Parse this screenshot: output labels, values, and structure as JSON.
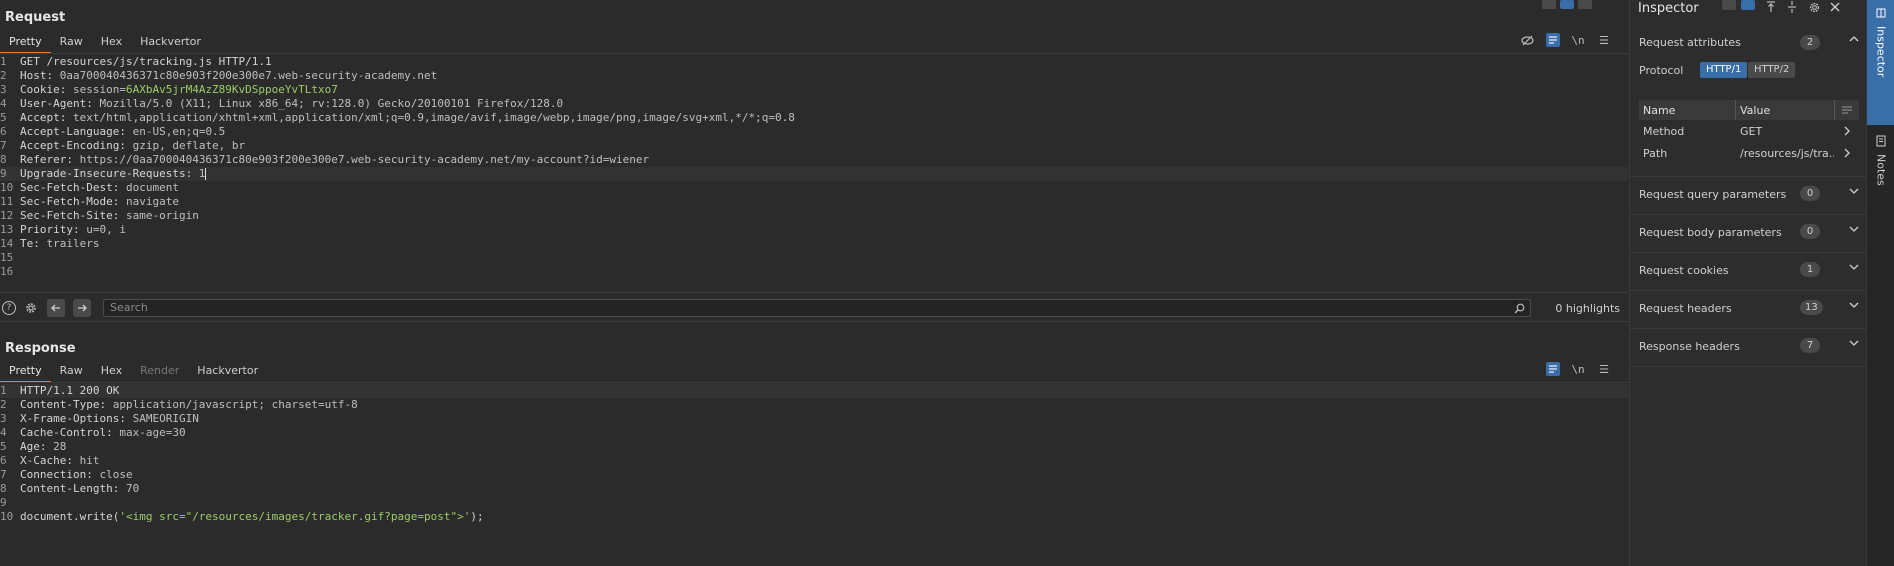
{
  "request": {
    "title": "Request",
    "tabs": [
      "Pretty",
      "Raw",
      "Hex",
      "Hackvertor"
    ],
    "active_tab": "Pretty",
    "lines": [
      {
        "n": "1",
        "name": "GET /resources/js/tracking.js HTTP/1.1",
        "value": ""
      },
      {
        "n": "2",
        "name": "Host:",
        "value": " 0aa700040436371c80e903f200e300e7.web-security-academy.net"
      },
      {
        "n": "3",
        "name": "Cookie:",
        "value": " session=",
        "extra": "6AXbAv5jrM4AzZ89KvDSppoeYvTLtxo7"
      },
      {
        "n": "4",
        "name": "User-Agent:",
        "value": " Mozilla/5.0 (X11; Linux x86_64; rv:128.0) Gecko/20100101 Firefox/128.0"
      },
      {
        "n": "5",
        "name": "Accept:",
        "value": " text/html,application/xhtml+xml,application/xml;q=0.9,image/avif,image/webp,image/png,image/svg+xml,*/*;q=0.8"
      },
      {
        "n": "6",
        "name": "Accept-Language:",
        "value": " en-US,en;q=0.5"
      },
      {
        "n": "7",
        "name": "Accept-Encoding:",
        "value": " gzip, deflate, br"
      },
      {
        "n": "8",
        "name": "Referer:",
        "value": " https://0aa700040436371c80e903f200e300e7.web-security-academy.net/my-account?id=wiener"
      },
      {
        "n": "9",
        "name": "Upgrade-Insecure-Requests:",
        "value": " 1",
        "cursor": true
      },
      {
        "n": "10",
        "name": "Sec-Fetch-Dest:",
        "value": " document"
      },
      {
        "n": "11",
        "name": "Sec-Fetch-Mode:",
        "value": " navigate"
      },
      {
        "n": "12",
        "name": "Sec-Fetch-Site:",
        "value": " same-origin"
      },
      {
        "n": "13",
        "name": "Priority:",
        "value": " u=0, i"
      },
      {
        "n": "14",
        "name": "Te:",
        "value": " trailers"
      },
      {
        "n": "15",
        "name": "",
        "value": ""
      },
      {
        "n": "16",
        "name": "",
        "value": ""
      }
    ]
  },
  "search": {
    "placeholder": "Search",
    "highlights": "0 highlights"
  },
  "response": {
    "title": "Response",
    "tabs": [
      "Pretty",
      "Raw",
      "Hex",
      "Render",
      "Hackvertor"
    ],
    "active_tab": "Pretty",
    "disabled_tab": "Render",
    "lines": [
      {
        "n": "1",
        "name": "HTTP/1.1 200 OK",
        "value": ""
      },
      {
        "n": "2",
        "name": "Content-Type:",
        "value": " application/javascript; charset=utf-8"
      },
      {
        "n": "3",
        "name": "X-Frame-Options:",
        "value": " SAMEORIGIN"
      },
      {
        "n": "4",
        "name": "Cache-Control:",
        "value": " max-age=30"
      },
      {
        "n": "5",
        "name": "Age:",
        "value": " 28"
      },
      {
        "n": "6",
        "name": "X-Cache:",
        "value": " hit"
      },
      {
        "n": "7",
        "name": "Connection:",
        "value": " close"
      },
      {
        "n": "8",
        "name": "Content-Length:",
        "value": " 70"
      },
      {
        "n": "9",
        "name": "",
        "value": ""
      },
      {
        "n": "10",
        "name": "document.write(",
        "value": "",
        "extra": "'<img src=\"/resources/images/tracker.gif?page=post\">'",
        "tail": ");"
      }
    ]
  },
  "inspector": {
    "title": "Inspector",
    "attributes": {
      "label": "Request attributes",
      "count": "2"
    },
    "protocol_label": "Protocol",
    "protocols": [
      "HTTP/1",
      "HTTP/2"
    ],
    "table": {
      "headers": [
        "Name",
        "Value"
      ],
      "rows": [
        {
          "name": "Method",
          "value": "GET"
        },
        {
          "name": "Path",
          "value": "/resources/js/tra..."
        }
      ]
    },
    "sections": [
      {
        "label": "Request query parameters",
        "count": "0"
      },
      {
        "label": "Request body parameters",
        "count": "0"
      },
      {
        "label": "Request cookies",
        "count": "1"
      },
      {
        "label": "Request headers",
        "count": "13"
      },
      {
        "label": "Response headers",
        "count": "7"
      }
    ]
  },
  "side_tabs": [
    "Inspector",
    "Notes"
  ],
  "icons": {
    "newline": "\\n",
    "menu": "☰",
    "chevron": "›",
    "expand": "⌄"
  },
  "colors": {
    "accent": "#e8743b",
    "active_icon": "#3a6ea8",
    "cookie": "#9ccc65"
  }
}
